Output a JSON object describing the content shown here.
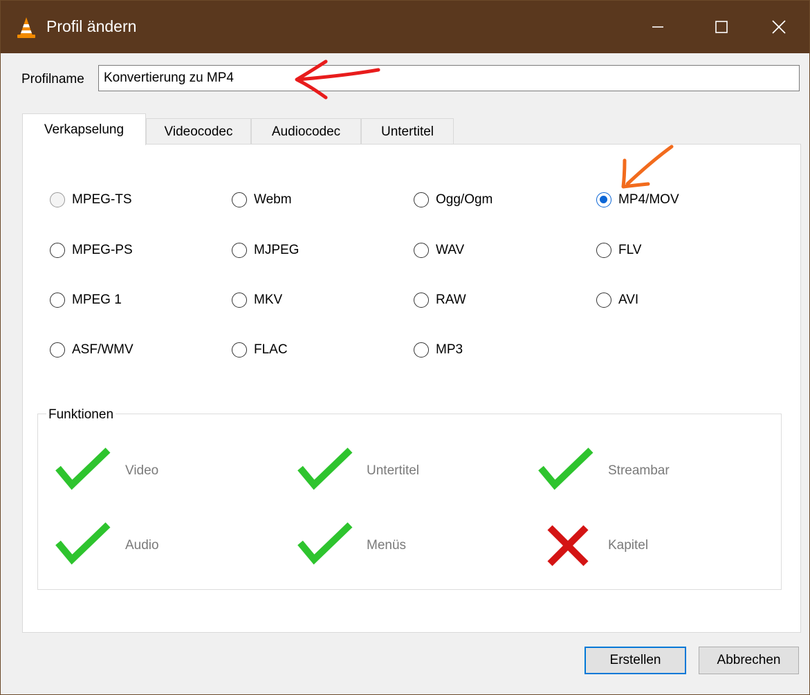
{
  "window": {
    "title": "Profil ändern",
    "title_bg": "#5a381e"
  },
  "profile": {
    "label": "Profilname",
    "value": "Konvertierung zu MP4"
  },
  "tabs": [
    {
      "label": "Verkapselung",
      "active": true
    },
    {
      "label": "Videocodec",
      "active": false
    },
    {
      "label": "Audiocodec",
      "active": false
    },
    {
      "label": "Untertitel",
      "active": false
    }
  ],
  "encapsulation": {
    "options": [
      {
        "label": "MPEG-TS",
        "checked": false,
        "disabled": true
      },
      {
        "label": "Webm",
        "checked": false
      },
      {
        "label": "Ogg/Ogm",
        "checked": false
      },
      {
        "label": "MP4/MOV",
        "checked": true
      },
      {
        "label": "MPEG-PS",
        "checked": false
      },
      {
        "label": "MJPEG",
        "checked": false
      },
      {
        "label": "WAV",
        "checked": false
      },
      {
        "label": "FLV",
        "checked": false
      },
      {
        "label": "MPEG 1",
        "checked": false
      },
      {
        "label": "MKV",
        "checked": false
      },
      {
        "label": "RAW",
        "checked": false
      },
      {
        "label": "AVI",
        "checked": false
      },
      {
        "label": "ASF/WMV",
        "checked": false
      },
      {
        "label": "FLAC",
        "checked": false
      },
      {
        "label": "MP3",
        "checked": false
      }
    ]
  },
  "features": {
    "title": "Funktionen",
    "items": [
      {
        "label": "Video",
        "supported": true
      },
      {
        "label": "Untertitel",
        "supported": true
      },
      {
        "label": "Streambar",
        "supported": true
      },
      {
        "label": "Audio",
        "supported": true
      },
      {
        "label": "Menüs",
        "supported": true
      },
      {
        "label": "Kapitel",
        "supported": false
      }
    ]
  },
  "buttons": {
    "create": "Erstellen",
    "cancel": "Abbrechen"
  },
  "colors": {
    "check": "#2ec42e",
    "cross": "#d41414",
    "radio_selected": "#0a66d6",
    "annotation_red": "#e81c1c",
    "annotation_orange": "#f26b1d"
  }
}
